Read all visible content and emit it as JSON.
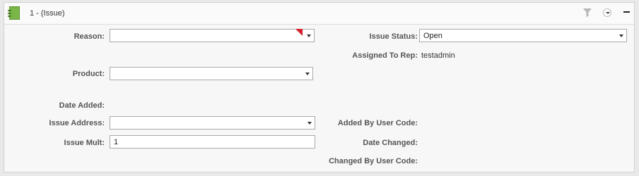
{
  "panel": {
    "title": "1 - (Issue)",
    "icons": {
      "app": "notebook-icon",
      "filter": "filter-icon",
      "dropdown": "chevron-down-icon",
      "collapse": "minus-icon"
    }
  },
  "form": {
    "reason": {
      "label": "Reason:",
      "value": ""
    },
    "product": {
      "label": "Product:",
      "value": ""
    },
    "date_added": {
      "label": "Date Added:"
    },
    "issue_address": {
      "label": "Issue Address:",
      "value": ""
    },
    "issue_mult": {
      "label": "Issue Mult:",
      "value": "1"
    },
    "issue_status": {
      "label": "Issue Status:",
      "value": "Open"
    },
    "assigned_to_rep": {
      "label": "Assigned To Rep:",
      "value": "testadmin"
    },
    "added_by_user_code": {
      "label": "Added By User Code:"
    },
    "date_changed": {
      "label": "Date Changed:"
    },
    "changed_by_user_code": {
      "label": "Changed By User Code:"
    }
  },
  "colors": {
    "required_marker": "#d4202c",
    "icon_green": "#7ab648"
  }
}
